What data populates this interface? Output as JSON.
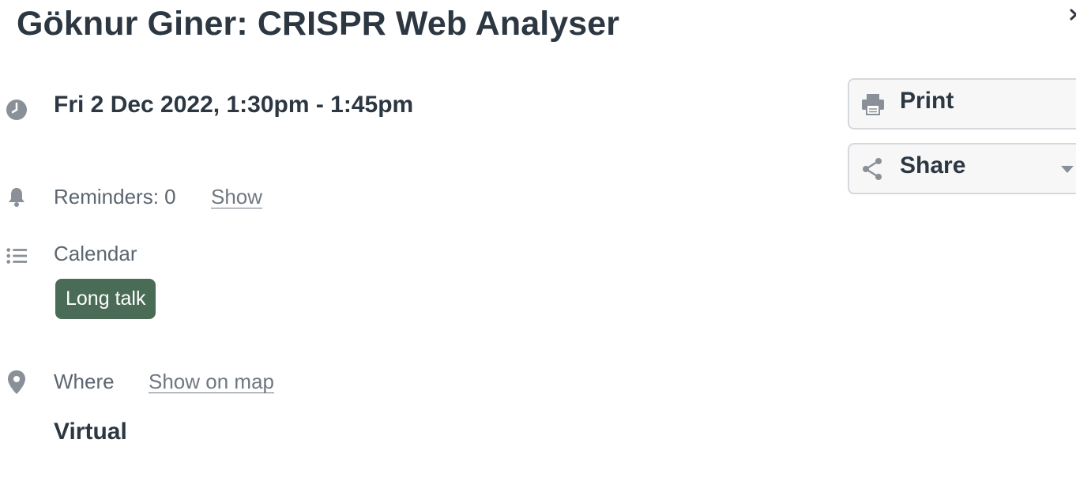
{
  "event": {
    "title": "Göknur Giner: CRISPR Web Analyser",
    "datetime": "Fri 2 Dec 2022, 1:30pm - 1:45pm",
    "reminders_label": "Reminders: 0",
    "reminders_link": "Show",
    "calendar_label": "Calendar",
    "calendar_tag": "Long talk",
    "where_label": "Where",
    "map_link": "Show on map",
    "venue": "Virtual"
  },
  "actions": {
    "print_label": "Print",
    "share_label": "Share"
  },
  "colors": {
    "tag_background": "#4a6b55",
    "title_text": "#2c3742",
    "icon_gray": "#8a9097"
  },
  "icons": {
    "clock": "clock-icon",
    "bell": "bell-icon",
    "list": "list-icon",
    "pin": "map-pin-icon",
    "printer": "printer-icon",
    "share": "share-icon",
    "close": "close-icon"
  }
}
